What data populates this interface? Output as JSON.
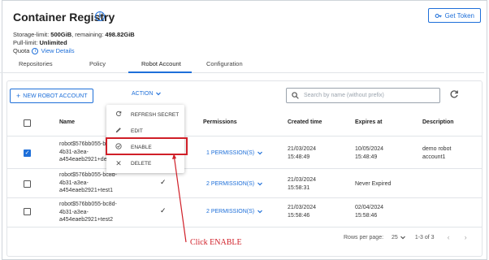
{
  "header": {
    "title": "Container Registry",
    "get_token_label": "Get Token",
    "storage_limit_label": "Storage-limit:",
    "storage_limit_value": "500GiB",
    "remaining_label": ", remaining:",
    "remaining_value": "498.82GiB",
    "pull_limit_label": "Pull-limit:",
    "pull_limit_value": "Unlimited",
    "quota_label": "Quota",
    "view_details_label": "View Details"
  },
  "tabs": [
    {
      "label": "Repositories"
    },
    {
      "label": "Policy"
    },
    {
      "label": "Robot Account"
    },
    {
      "label": "Configuration"
    }
  ],
  "toolbar": {
    "new_robot_label": "NEW ROBOT ACCOUNT",
    "action_label": "ACTION",
    "search_placeholder": "Search by name (without prefix)"
  },
  "menu": {
    "items": [
      {
        "label": "REFRESH SECRET",
        "icon": "refresh-icon"
      },
      {
        "label": "EDIT",
        "icon": "pencil-icon"
      },
      {
        "label": "ENABLE",
        "icon": "enable-icon"
      },
      {
        "label": "DELETE",
        "icon": "close-icon"
      }
    ]
  },
  "table": {
    "columns": [
      "Name",
      "Permissions",
      "Created time",
      "Expires at",
      "Description"
    ],
    "rows": [
      {
        "name_l1": "robot$576bb055-bc8d-",
        "name_l2": "4b31-a3ea-",
        "name_l3": "a454eaeb2921+demo1",
        "permissions": "1 PERMISSION(S)",
        "created_date": "21/03/2024",
        "created_time": "15:48:49",
        "expires_date": "10/05/2024",
        "expires_time": "15:48:49",
        "desc_l1": "demo robot",
        "desc_l2": "account1",
        "checked": true
      },
      {
        "name_l1": "robot$576bb055-bc8d-",
        "name_l2": "4b31-a3ea-",
        "name_l3": "a454eaeb2921+test1",
        "permissions": "2 PERMISSION(S)",
        "created_date": "21/03/2024",
        "created_time": "15:58:31",
        "expires_date": "Never Expired",
        "expires_time": "",
        "desc_l1": "",
        "desc_l2": "",
        "checked": false
      },
      {
        "name_l1": "robot$576bb055-bc8d-",
        "name_l2": "4b31-a3ea-",
        "name_l3": "a454eaeb2921+test2",
        "permissions": "2 PERMISSION(S)",
        "created_date": "21/03/2024",
        "created_time": "15:58:46",
        "expires_date": "02/04/2024",
        "expires_time": "15:58:46",
        "desc_l1": "",
        "desc_l2": "",
        "checked": false
      }
    ]
  },
  "footer": {
    "rows_per_page_label": "Rows per page:",
    "rows_per_page_value": "25",
    "range": "1-3 of 3"
  },
  "annotation": {
    "label": "Click ENABLE"
  },
  "colors": {
    "accent": "#1e6fd9",
    "annotation": "#d01f28"
  }
}
